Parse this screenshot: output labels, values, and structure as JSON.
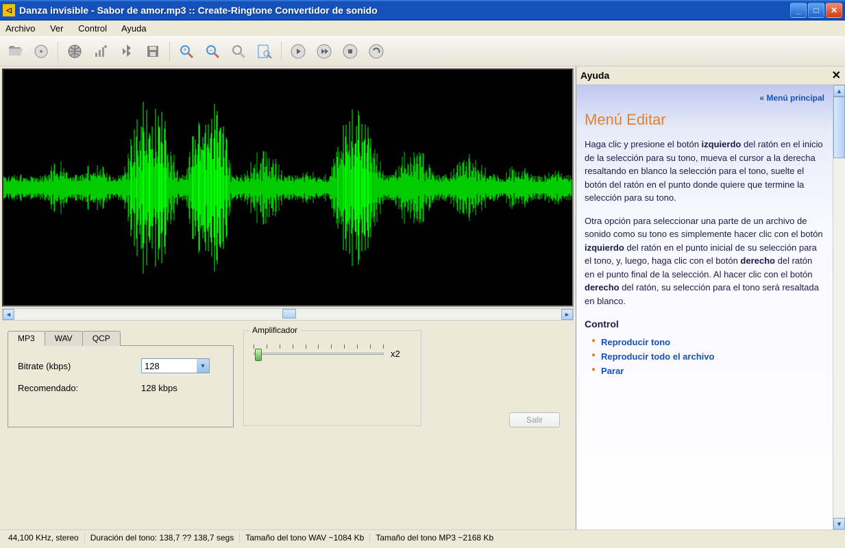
{
  "titlebar": {
    "title": "Danza invisible - Sabor de amor.mp3 :: Create-Ringtone Convertidor de sonido"
  },
  "menubar": {
    "items": [
      "Archivo",
      "Ver",
      "Control",
      "Ayuda"
    ]
  },
  "toolbar_icons": [
    "open-folder-icon",
    "cd-icon",
    "globe-icon",
    "signal-icon",
    "bluetooth-icon",
    "save-icon",
    "zoom-in-icon",
    "zoom-out-icon",
    "zoom-select-icon",
    "zoom-fit-icon",
    "play-icon",
    "play-all-icon",
    "stop-icon",
    "loop-icon"
  ],
  "tabs": {
    "items": [
      "MP3",
      "WAV",
      "QCP"
    ],
    "bitrate_label": "Bitrate (kbps)",
    "bitrate_value": "128",
    "recommended_label": "Recomendado:",
    "recommended_value": "128 kbps"
  },
  "amplifier": {
    "legend": "Amplificador",
    "multiplier": "x2"
  },
  "exit_label": "Salir",
  "help": {
    "title": "Ayuda",
    "back_link": "« Menú principal",
    "heading": "Menú Editar",
    "para1_pre": "Haga clic y presione el botón ",
    "para1_bold1": "izquierdo",
    "para1_post": " del ratón en el inicio de la selección para su tono, mueva el cursor a la derecha resaltando en blanco la selección para el tono, suelte el botón del ratón en el punto donde quiere que termine la selección para su tono.",
    "para2_pre": "Otra opción para seleccionar una parte de un archivo de sonido como su tono es simplemente hacer clic con el botón ",
    "para2_bold1": "izquierdo",
    "para2_mid1": " del ratón en el punto inicial de su selección para el tono, y, luego, haga clic con el botón ",
    "para2_bold2": "derecho",
    "para2_mid2": " del ratón en el punto final de la selección. Al hacer clic con el botón ",
    "para2_bold3": "derecho",
    "para2_post": " del ratón, su selección para el tono será resaltada en blanco.",
    "control_heading": "Control",
    "control_items": [
      "Reproducir tono",
      "Reproducir todo el archivo",
      "Parar"
    ]
  },
  "statusbar": {
    "freq": "44,100 KHz, stereo",
    "duration": "Duración del tono: 138,7 ?? 138,7 segs",
    "wav_size": "Tamaño del tono WAV ~1084 Kb",
    "mp3_size": "Tamaño del tono MP3 ~2168 Kb"
  }
}
